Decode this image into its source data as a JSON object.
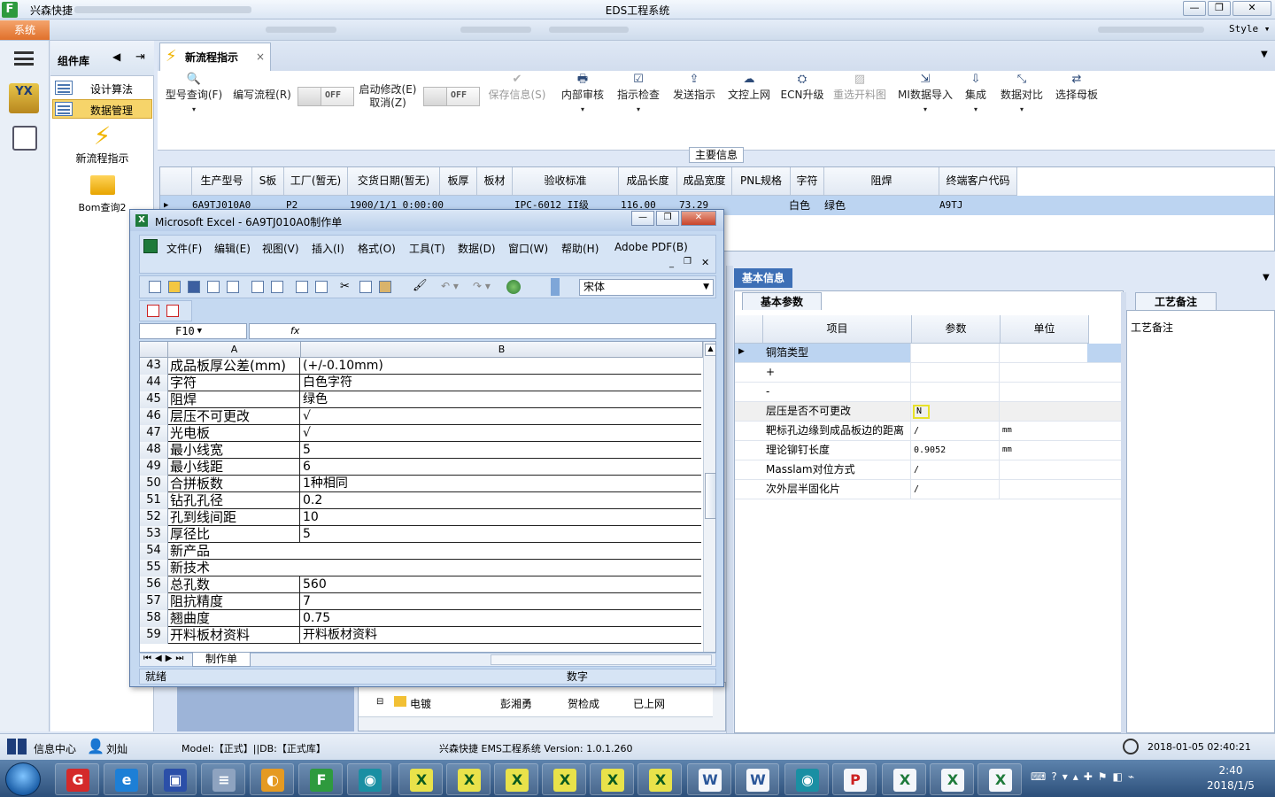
{
  "window": {
    "app_name": "兴森快捷",
    "title": "EDS工程系统",
    "style_label": "Style",
    "system_button": "系统"
  },
  "sidebar": {
    "header": "组件库",
    "items": [
      {
        "label": "设计算法",
        "selected": false
      },
      {
        "label": "数据管理",
        "selected": true
      },
      {
        "label": "新流程指示"
      },
      {
        "label": "Bom查询2"
      }
    ]
  },
  "doc_tab": {
    "label": "新流程指示"
  },
  "toolbar": {
    "items": [
      {
        "label": "型号查询(F)",
        "icon": "search-icon"
      },
      {
        "label": "编写流程(R)",
        "icon": ""
      },
      {
        "label": "启动修改(E)",
        "label2": "取消(Z)",
        "icon": ""
      },
      {
        "label": "保存信息(S)",
        "icon": "check-icon",
        "disabled": true
      },
      {
        "label": "内部审核",
        "icon": "printer-icon"
      },
      {
        "label": "指示检查",
        "icon": "checkbox-icon"
      },
      {
        "label": "发送指示",
        "icon": "upload-icon"
      },
      {
        "label": "文控上网",
        "icon": "cloud-upload-icon"
      },
      {
        "label": "ECN升级",
        "icon": "ecn-icon"
      },
      {
        "label": "重选开料图",
        "icon": "image-icon",
        "disabled": true
      },
      {
        "label": "MI数据导入",
        "icon": "import-icon"
      },
      {
        "label": "集成",
        "icon": "download-icon"
      },
      {
        "label": "数据对比",
        "icon": "compare-icon"
      },
      {
        "label": "选择母板",
        "icon": "shuffle-icon"
      }
    ],
    "toggle_off": "OFF"
  },
  "main_info": {
    "legend": "主要信息",
    "columns": [
      "生产型号",
      "S板",
      "工厂(暂无)",
      "交货日期(暂无)",
      "板厚",
      "板材",
      "验收标准",
      "成品长度",
      "成品宽度",
      "PNL规格",
      "字符",
      "阻焊",
      "终端客户代码"
    ],
    "row": [
      "6A9TJ010A0",
      "P2",
      "",
      "1900/1/1 0:00:00",
      "",
      "",
      "IPC-6012 II级",
      "116.00",
      "73.29",
      "",
      "白色",
      "绿色",
      "A9TJ"
    ]
  },
  "basic_info": {
    "tab": "基本信息",
    "subtab": "基本参数",
    "columns": [
      "项目",
      "参数",
      "单位"
    ],
    "rows": [
      {
        "item": "铜箔类型",
        "param": "",
        "unit": ""
      },
      {
        "item": "+",
        "param": "",
        "unit": ""
      },
      {
        "item": "-",
        "param": "",
        "unit": ""
      },
      {
        "item": "层压是否不可更改",
        "param": "N",
        "unit": ""
      },
      {
        "item": "靶标孔边缘到成品板边的距离",
        "param": "/",
        "unit": "mm"
      },
      {
        "item": "理论铆钉长度",
        "param": "0.9052",
        "unit": "mm"
      },
      {
        "item": "Masslam对位方式",
        "param": "/",
        "unit": ""
      },
      {
        "item": "次外层半固化片",
        "param": "/",
        "unit": ""
      }
    ]
  },
  "process_note": {
    "tab": "工艺备注",
    "label": "工艺备注"
  },
  "tree": {
    "row": {
      "name": "电镀",
      "person1": "彭湘勇",
      "person2": "贺检成",
      "status": "已上网"
    }
  },
  "excel": {
    "title": "Microsoft Excel - 6A9TJ010A0制作单",
    "menu": [
      "文件(F)",
      "编辑(E)",
      "视图(V)",
      "插入(I)",
      "格式(O)",
      "工具(T)",
      "数据(D)",
      "窗口(W)",
      "帮助(H)",
      "Adobe PDF(B)"
    ],
    "font": "宋体",
    "cell_ref": "F10",
    "fx": "fx",
    "col_a": "A",
    "col_b": "B",
    "rows": [
      {
        "n": "43",
        "a": "成品板厚公差(mm)",
        "b": "(+/-0.10mm)"
      },
      {
        "n": "44",
        "a": "字符",
        "b": "白色字符"
      },
      {
        "n": "45",
        "a": "阻焊",
        "b": "绿色"
      },
      {
        "n": "46",
        "a": "层压不可更改",
        "b": "√"
      },
      {
        "n": "47",
        "a": "光电板",
        "b": "√"
      },
      {
        "n": "48",
        "a": "最小线宽",
        "b": "5"
      },
      {
        "n": "49",
        "a": "最小线距",
        "b": "6"
      },
      {
        "n": "50",
        "a": "合拼板数",
        "b": "1种相同"
      },
      {
        "n": "51",
        "a": "钻孔孔径",
        "b": "0.2"
      },
      {
        "n": "52",
        "a": "孔到线间距",
        "b": "10"
      },
      {
        "n": "53",
        "a": "厚径比",
        "b": "5"
      },
      {
        "n": "54",
        "a": "新产品",
        "b": ""
      },
      {
        "n": "55",
        "a": "新技术",
        "b": ""
      },
      {
        "n": "56",
        "a": "总孔数",
        "b": "560"
      },
      {
        "n": "57",
        "a": "阻抗精度",
        "b": "7"
      },
      {
        "n": "58",
        "a": "翘曲度",
        "b": "0.75"
      },
      {
        "n": "59",
        "a": "开料板材资料",
        "b": "开料板材资料"
      }
    ],
    "sheet_tab": "制作单",
    "status_ready": "就绪",
    "status_num": "数字"
  },
  "statusbar": {
    "info_center": "信息中心",
    "user": "刘灿",
    "model": "Model:【正式】||DB:【正式库】",
    "version": "兴森快捷 EMS工程系统 Version: 1.0.1.260",
    "datetime": "2018-01-05 02:40:21"
  },
  "taskbar": {
    "time": "2:40",
    "date": "2018/1/5"
  },
  "colors": {
    "accent": "#3d6fb6",
    "selected_row": "#bcd4f1",
    "highlight": "#e8e22a",
    "nav_selected": "#f6d46a"
  }
}
